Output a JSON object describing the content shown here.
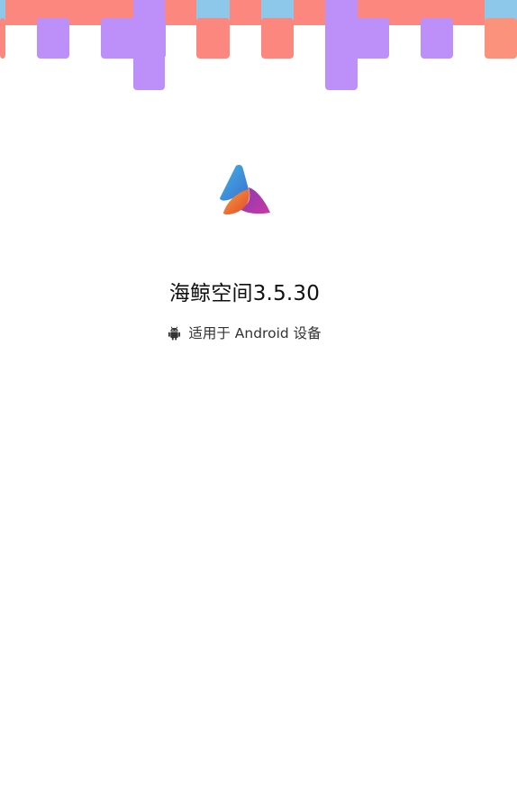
{
  "app": {
    "title": "海鲸空间3.5.30",
    "platform_text": "适用于 Android 设备"
  },
  "icons": {
    "logo": "app-logo-icon",
    "platform": "android-icon"
  },
  "colors": {
    "banner_salmon": "#fb877f",
    "banner_purple": "#bc8ff9",
    "banner_blue": "#8dc7ea",
    "banner_orange": "#fb927b",
    "title_text": "#111111",
    "subtitle_text": "#333333",
    "background": "#ffffff"
  }
}
